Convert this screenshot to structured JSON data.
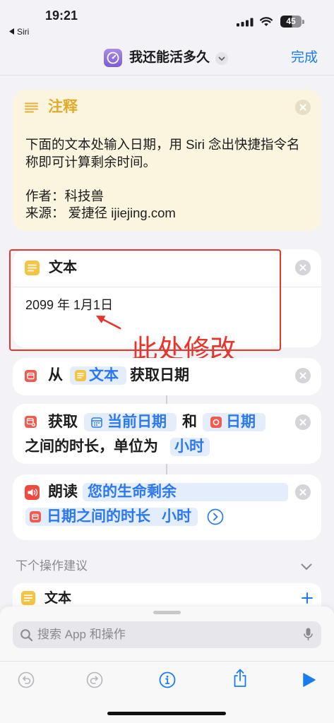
{
  "status_bar": {
    "time": "19:21",
    "back_app": "Siri",
    "battery": "45"
  },
  "nav": {
    "title": "我还能活多久",
    "done": "完成"
  },
  "comment_card": {
    "title": "注释",
    "body_lines": [
      "下面的文本处输入日期，用 Siri 念出快捷指令名",
      "称即可计算剩余时间。"
    ],
    "author": "作者：科技兽",
    "source": "来源： 爱捷径 ijiejing.com"
  },
  "text_card": {
    "title": "文本",
    "value": "2099 年 1月1日"
  },
  "annotation": {
    "label": "此处修改"
  },
  "get_dates_card": {
    "prefix": "从",
    "input_token": "文本",
    "suffix": "获取日期"
  },
  "time_between_card": {
    "verb": "获取",
    "start_token": "当前日期",
    "conjunction": "和",
    "end_token": "日期",
    "phrase": "之间的时长，单位为",
    "unit_token": "小时"
  },
  "speak_card": {
    "verb": "朗读",
    "text": "您的生命剩余",
    "var_name": "日期之间的时长",
    "var_unit": "小时"
  },
  "suggestions": {
    "header": "下个操作建议",
    "items": [
      {
        "label": "文本"
      }
    ]
  },
  "search": {
    "placeholder": "搜索 App 和操作"
  },
  "icons": {
    "app": "shortcut-gauge-icon",
    "comment": "lines-icon",
    "text": "text-icon",
    "get_dates": "calendar-icon",
    "time_between": "calendar-plus-icon",
    "speak": "speaker-icon",
    "toolbar": [
      "undo-icon",
      "redo-icon",
      "info-icon",
      "share-icon",
      "play-icon"
    ]
  },
  "colors": {
    "accent": "#1a7cf5",
    "token_text": "#2a78f3",
    "token_bg": "#e4edfc",
    "annotation": "#e8342a",
    "comment_bg": "#fbf5df",
    "comment_title": "#e1ab2c",
    "action_red": "#f25a4f",
    "text_yellow": "#f5c444"
  }
}
